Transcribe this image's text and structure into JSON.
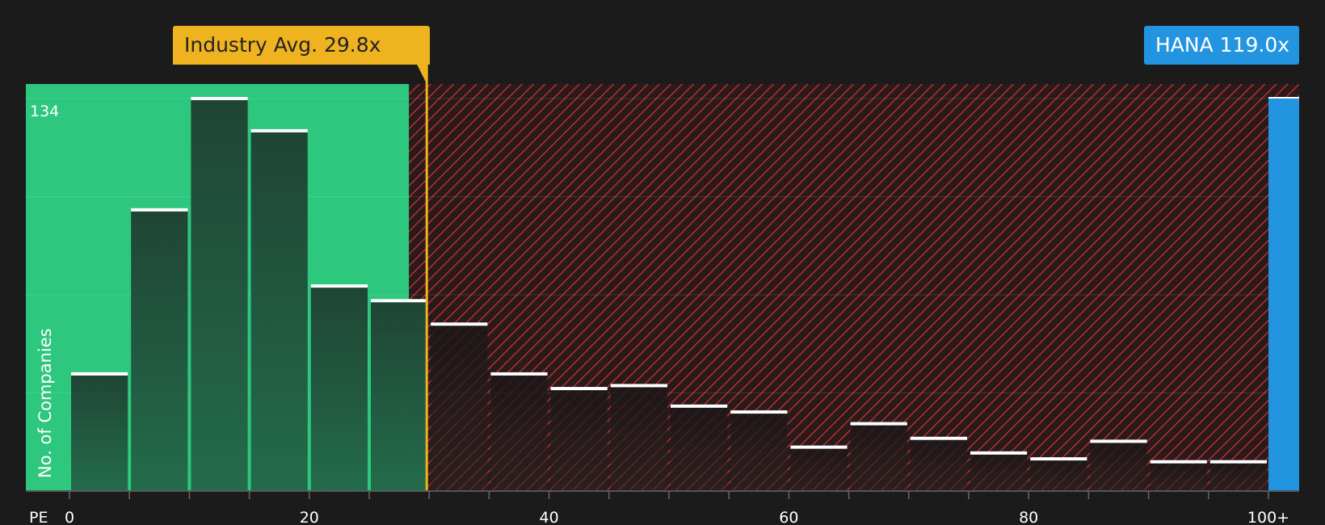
{
  "chart_data": {
    "type": "bar",
    "xlabel": "PE",
    "ylabel": "No. of Companies",
    "y_max_label": "134",
    "ylim": [
      0,
      134
    ],
    "x_tick_labels": [
      "0",
      "20",
      "40",
      "60",
      "80",
      "100+"
    ],
    "bin_width": 5,
    "bins": [
      {
        "x_start": 0,
        "x_end": 5,
        "count": 40
      },
      {
        "x_start": 5,
        "x_end": 10,
        "count": 96
      },
      {
        "x_start": 10,
        "x_end": 15,
        "count": 134
      },
      {
        "x_start": 15,
        "x_end": 20,
        "count": 123
      },
      {
        "x_start": 20,
        "x_end": 25,
        "count": 70
      },
      {
        "x_start": 25,
        "x_end": 30,
        "count": 65
      },
      {
        "x_start": 30,
        "x_end": 35,
        "count": 57
      },
      {
        "x_start": 35,
        "x_end": 40,
        "count": 40
      },
      {
        "x_start": 40,
        "x_end": 45,
        "count": 35
      },
      {
        "x_start": 45,
        "x_end": 50,
        "count": 36
      },
      {
        "x_start": 50,
        "x_end": 55,
        "count": 29
      },
      {
        "x_start": 55,
        "x_end": 60,
        "count": 27
      },
      {
        "x_start": 60,
        "x_end": 65,
        "count": 15
      },
      {
        "x_start": 65,
        "x_end": 70,
        "count": 23
      },
      {
        "x_start": 70,
        "x_end": 75,
        "count": 18
      },
      {
        "x_start": 75,
        "x_end": 80,
        "count": 13
      },
      {
        "x_start": 80,
        "x_end": 85,
        "count": 11
      },
      {
        "x_start": 85,
        "x_end": 90,
        "count": 17
      },
      {
        "x_start": 90,
        "x_end": 95,
        "count": 10
      },
      {
        "x_start": 95,
        "x_end": 100,
        "count": 10
      }
    ],
    "industry_average": {
      "label": "Industry Avg. 29.8x",
      "value": 29.8
    },
    "company": {
      "label": "HANA 119.0x",
      "value": 119.0,
      "bar_height_count": 134
    },
    "grid": true,
    "colors": {
      "background": "#1b1b1b",
      "good_zone": "#2ec77e",
      "bad_zone_stripe": "#d2343a",
      "bar_fill": "#1f4a37",
      "bar_top": "#ffffff",
      "industry_line": "#eeb31f",
      "company": "#2394e0"
    }
  }
}
